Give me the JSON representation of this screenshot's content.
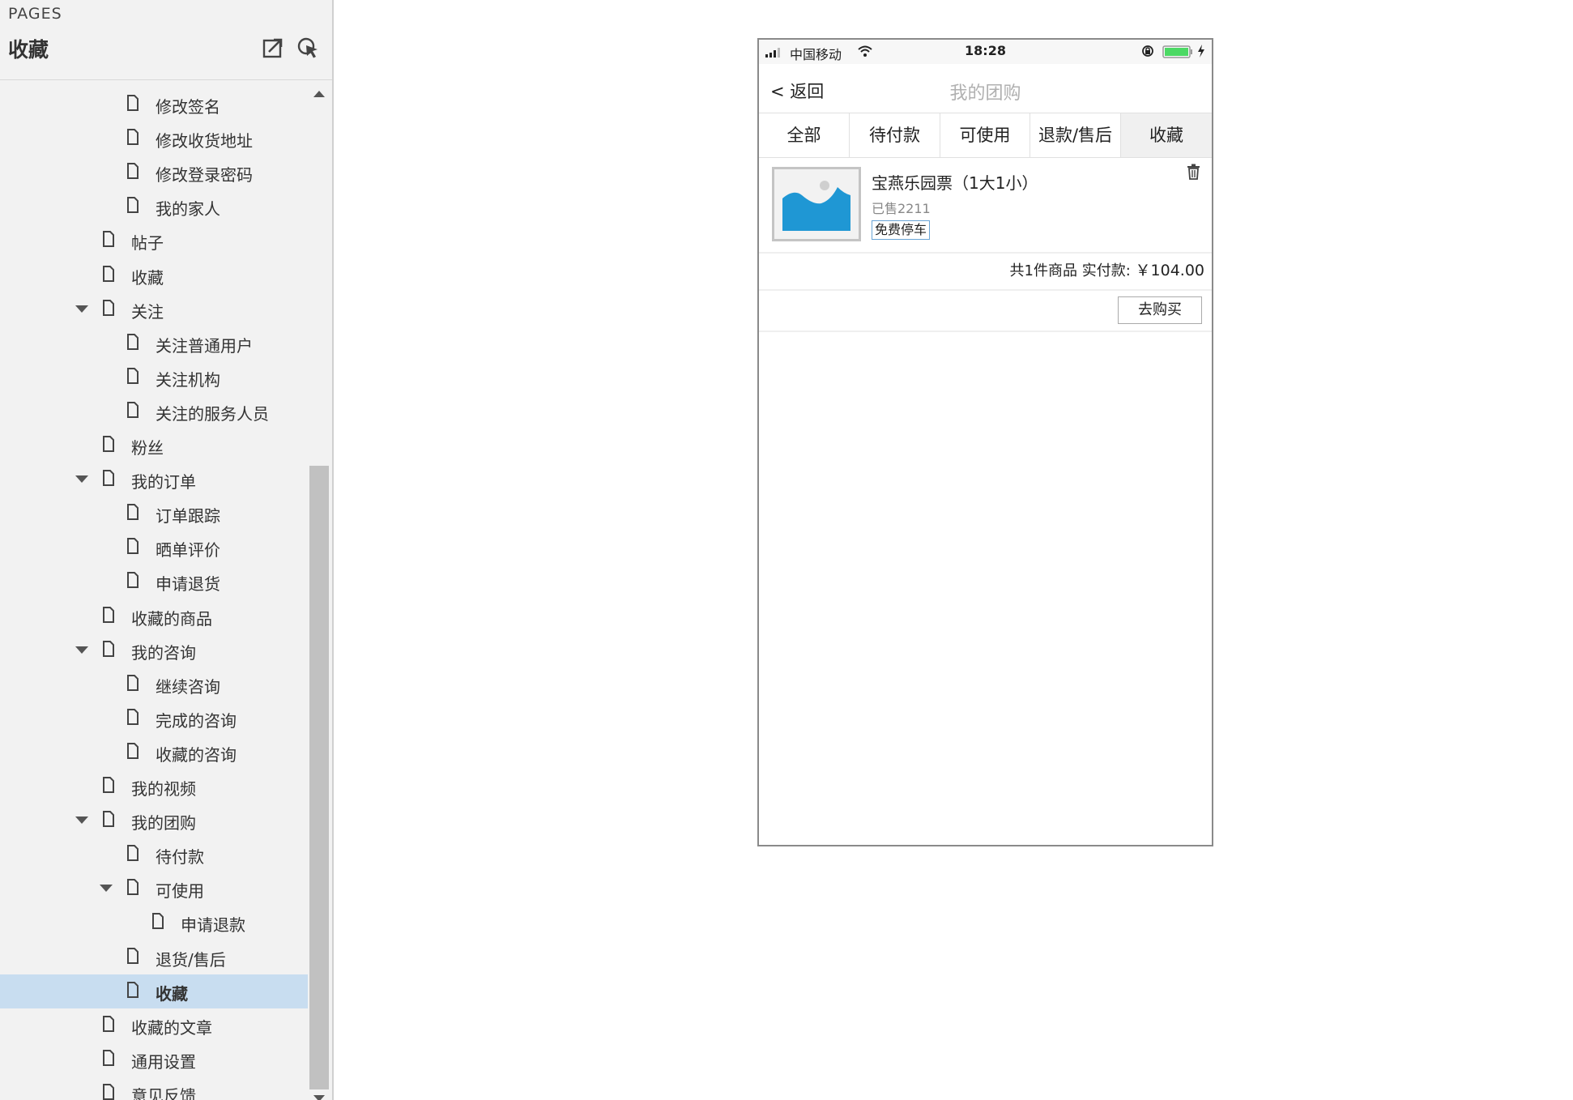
{
  "sidebar": {
    "pages_label": "PAGES",
    "current_page": "收藏",
    "tree": [
      {
        "label": "修改签名",
        "level": 3,
        "caret": false
      },
      {
        "label": "修改收货地址",
        "level": 3,
        "caret": false
      },
      {
        "label": "修改登录密码",
        "level": 3,
        "caret": false
      },
      {
        "label": "我的家人",
        "level": 3,
        "caret": false
      },
      {
        "label": "帖子",
        "level": 2,
        "caret": false
      },
      {
        "label": "收藏",
        "level": 2,
        "caret": false
      },
      {
        "label": "关注",
        "level": 2,
        "caret": true
      },
      {
        "label": "关注普通用户",
        "level": 3,
        "caret": false
      },
      {
        "label": "关注机构",
        "level": 3,
        "caret": false
      },
      {
        "label": "关注的服务人员",
        "level": 3,
        "caret": false
      },
      {
        "label": "粉丝",
        "level": 2,
        "caret": false
      },
      {
        "label": "我的订单",
        "level": 2,
        "caret": true
      },
      {
        "label": "订单跟踪",
        "level": 3,
        "caret": false
      },
      {
        "label": "晒单评价",
        "level": 3,
        "caret": false
      },
      {
        "label": "申请退货",
        "level": 3,
        "caret": false
      },
      {
        "label": "收藏的商品",
        "level": 2,
        "caret": false
      },
      {
        "label": "我的咨询",
        "level": 2,
        "caret": true
      },
      {
        "label": "继续咨询",
        "level": 3,
        "caret": false
      },
      {
        "label": "完成的咨询",
        "level": 3,
        "caret": false
      },
      {
        "label": "收藏的咨询",
        "level": 3,
        "caret": false
      },
      {
        "label": "我的视频",
        "level": 2,
        "caret": false
      },
      {
        "label": "我的团购",
        "level": 2,
        "caret": true
      },
      {
        "label": "待付款",
        "level": 3,
        "caret": false
      },
      {
        "label": "可使用",
        "level": 3,
        "caret": true
      },
      {
        "label": "申请退款",
        "level": 4,
        "caret": false
      },
      {
        "label": "退货/售后",
        "level": 3,
        "caret": false
      },
      {
        "label": "收藏",
        "level": 3,
        "caret": false,
        "selected": true
      },
      {
        "label": "收藏的文章",
        "level": 2,
        "caret": false
      },
      {
        "label": "通用设置",
        "level": 2,
        "caret": false
      },
      {
        "label": "意见反馈",
        "level": 2,
        "caret": false
      }
    ]
  },
  "phone": {
    "status": {
      "carrier": "中国移动",
      "time": "18:28"
    },
    "nav": {
      "back_label": "< 返回",
      "title": "我的团购"
    },
    "tabs": [
      {
        "label": "全部"
      },
      {
        "label": "待付款"
      },
      {
        "label": "可使用"
      },
      {
        "label": "退款/售后"
      },
      {
        "label": "收藏",
        "active": true
      }
    ],
    "product": {
      "name": "宝燕乐园票（1大1小）",
      "sold": "已售2211",
      "tag": "免费停车"
    },
    "summary": {
      "text": "共1件商品 实付款:",
      "price": "￥104.00"
    },
    "buy_button": "去购买"
  },
  "colors": {
    "selected_bg": "#c8ddf0",
    "image_placeholder_blue": "#1f97d4",
    "battery_green": "#4cd964",
    "tag_border": "#6aa5d6"
  },
  "icons": [
    "export-icon",
    "pointer-icon",
    "caret-down-icon",
    "document-icon",
    "image-placeholder-icon",
    "trash-icon",
    "wifi-icon",
    "signal-icon",
    "battery-icon",
    "lock-rotation-icon",
    "charging-bolt-icon"
  ]
}
